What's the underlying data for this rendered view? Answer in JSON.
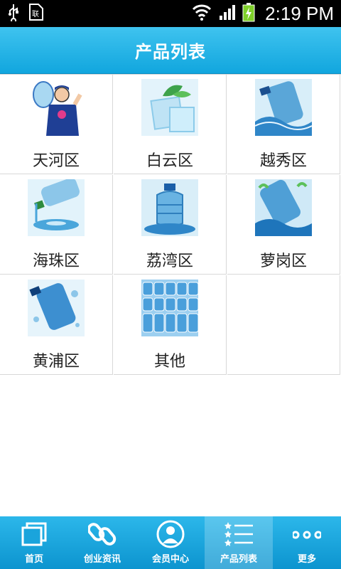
{
  "status_bar": {
    "time": "2:19 PM",
    "icons": [
      "usb-icon",
      "sim-icon",
      "wifi-icon",
      "signal-icon",
      "battery-charging-icon"
    ]
  },
  "header": {
    "title": "产品列表"
  },
  "products": [
    {
      "label": "天河区",
      "image": "delivery-man-water-bottle-image"
    },
    {
      "label": "白云区",
      "image": "ice-cube-mint-image"
    },
    {
      "label": "越秀区",
      "image": "water-bottle-splash-image"
    },
    {
      "label": "海珠区",
      "image": "pouring-bottle-image"
    },
    {
      "label": "荔湾区",
      "image": "large-water-jug-image"
    },
    {
      "label": "萝岗区",
      "image": "tilted-bottle-splash-image"
    },
    {
      "label": "黄浦区",
      "image": "bottle-bubbles-image"
    },
    {
      "label": "其他",
      "image": "bottle-warehouse-image"
    }
  ],
  "tabbar": {
    "items": [
      {
        "label": "首页",
        "icon": "home-pages-icon"
      },
      {
        "label": "创业资讯",
        "icon": "link-chain-icon"
      },
      {
        "label": "会员中心",
        "icon": "member-avatar-icon"
      },
      {
        "label": "产品列表",
        "icon": "list-icon",
        "active": true
      },
      {
        "label": "更多",
        "icon": "more-dots-icon"
      }
    ]
  },
  "colors": {
    "accent": "#11a6de",
    "grid_line": "#d8d8d8",
    "text": "#222222"
  }
}
